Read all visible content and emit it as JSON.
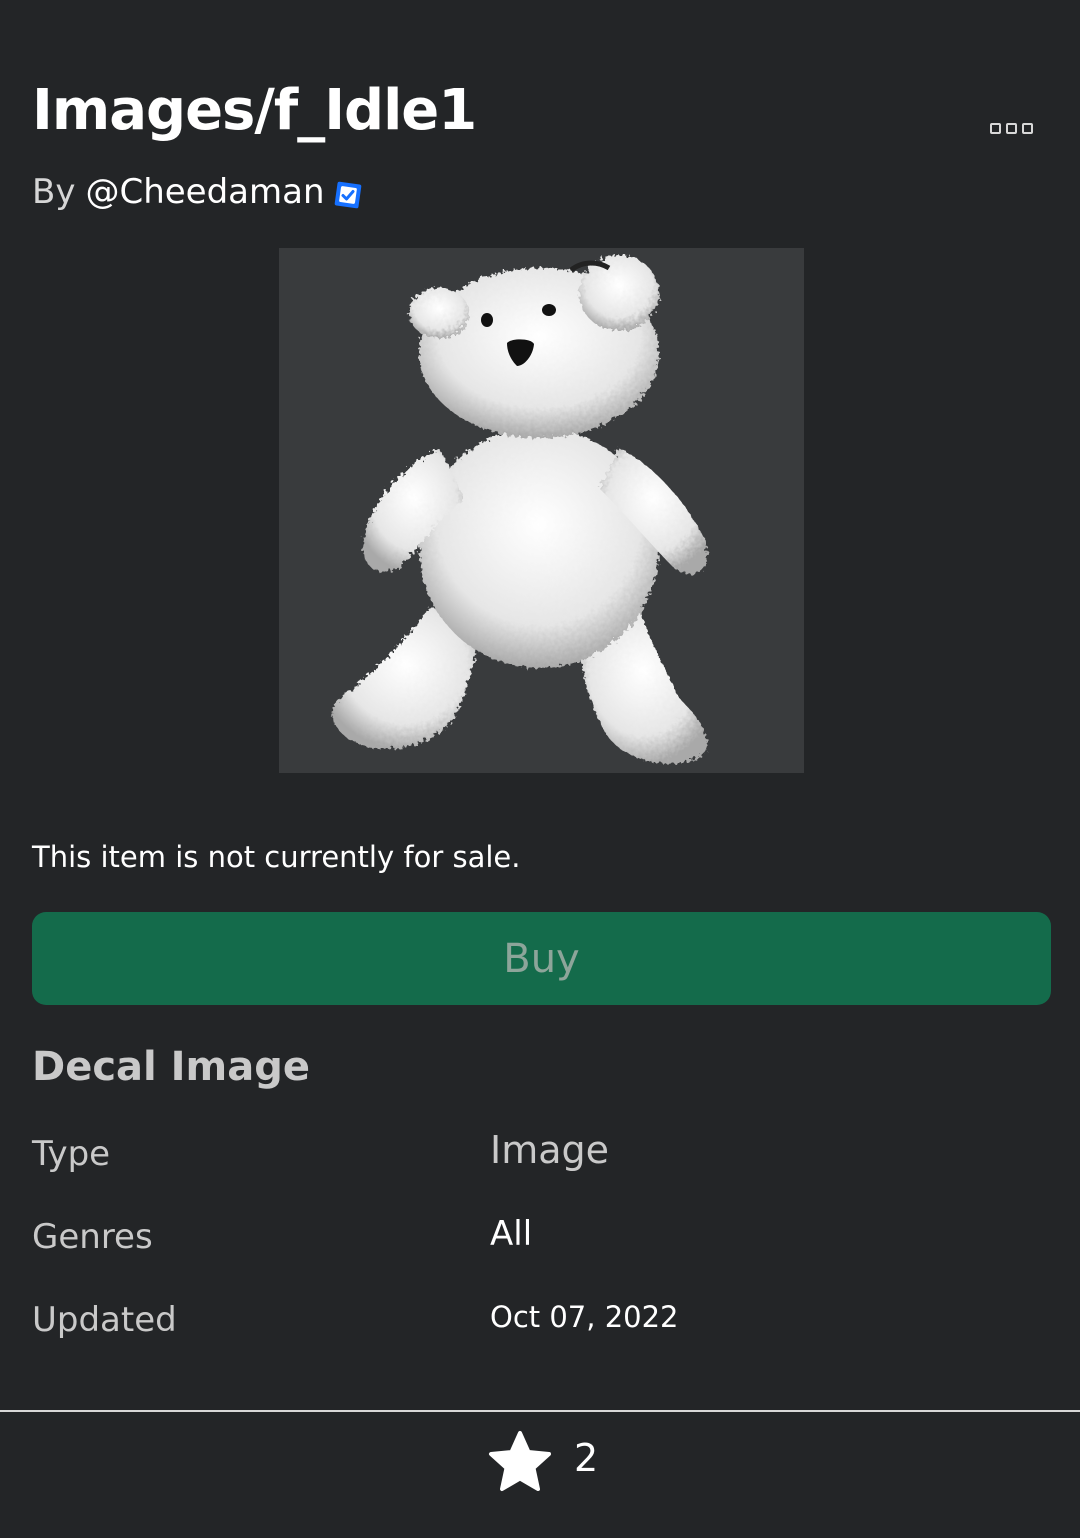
{
  "header": {
    "title": "Images/f_Idle1",
    "more_icon": "more-options-icon"
  },
  "creator": {
    "prefix": "By",
    "name": "@Cheedaman",
    "verified_icon": "verified-badge-icon",
    "verified_color": "#1670ff"
  },
  "thumbnail": {
    "subject": "teddy-bear-image"
  },
  "sale": {
    "notice": "This item is not currently for sale.",
    "buy_label": "Buy",
    "buy_color": "#146b4b"
  },
  "details": {
    "section_title": "Decal Image",
    "rows": [
      {
        "label": "Type",
        "value": "Image"
      },
      {
        "label": "Genres",
        "value": "All"
      },
      {
        "label": "Updated",
        "value": "Oct 07, 2022"
      }
    ]
  },
  "footer": {
    "favorite_icon": "star-icon",
    "favorite_count": "2"
  }
}
